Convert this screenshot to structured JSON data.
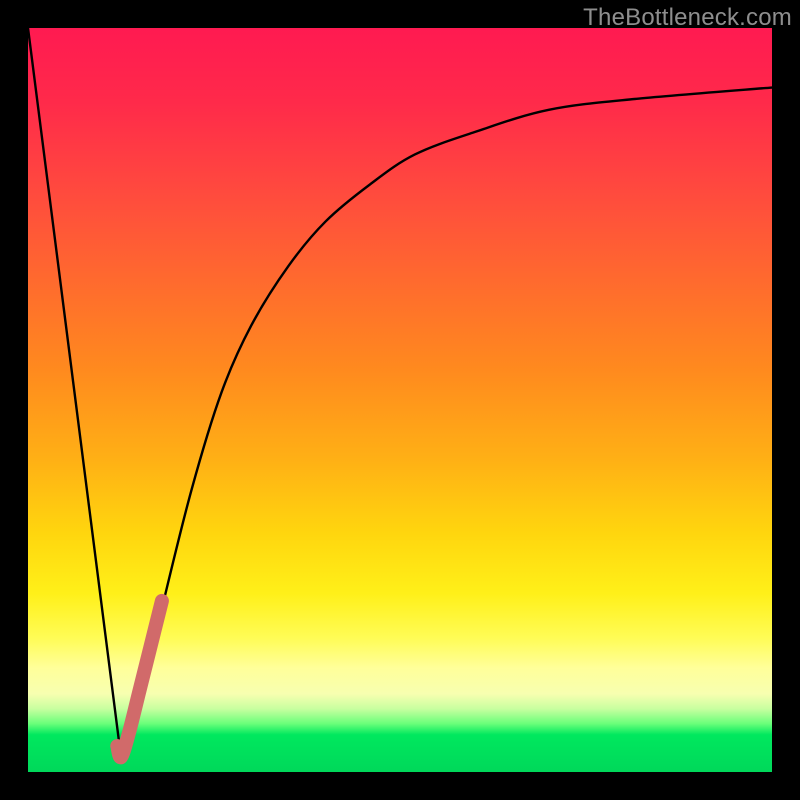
{
  "watermark": "TheBottleneck.com",
  "colors": {
    "background": "#000000",
    "curve": "#000000",
    "highlight": "#d16a6a"
  },
  "chart_data": {
    "type": "line",
    "title": "",
    "xlabel": "",
    "ylabel": "",
    "xlim": [
      0,
      100
    ],
    "ylim": [
      0,
      100
    ],
    "grid": false,
    "series": [
      {
        "name": "left-descent",
        "x": [
          0,
          12.5
        ],
        "y": [
          100,
          2
        ]
      },
      {
        "name": "right-curve",
        "x": [
          12.5,
          15,
          18,
          22,
          26,
          30,
          35,
          40,
          46,
          52,
          60,
          70,
          82,
          100
        ],
        "y": [
          2,
          9,
          22,
          38,
          51,
          60,
          68,
          74,
          79,
          83,
          86,
          89,
          90.5,
          92
        ]
      },
      {
        "name": "highlight-segment",
        "x": [
          12.0,
          12.5,
          13.5,
          15.0,
          16.5,
          18.0
        ],
        "y": [
          3.5,
          2.0,
          5.0,
          11.0,
          17.0,
          23.0
        ]
      }
    ],
    "annotations": []
  }
}
